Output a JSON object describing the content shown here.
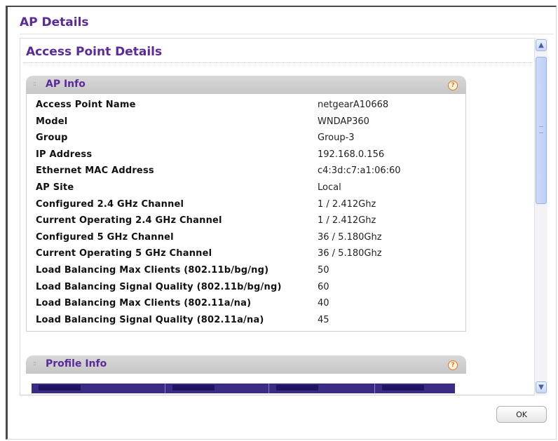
{
  "dialog": {
    "title": "AP Details",
    "ok_label": "OK"
  },
  "section": {
    "title": "Access Point Details"
  },
  "ap_info": {
    "title": "AP Info",
    "help": "?",
    "rows": [
      {
        "label": "Access Point Name",
        "value": "netgearA10668"
      },
      {
        "label": "Model",
        "value": "WNDAP360"
      },
      {
        "label": "Group",
        "value": "Group-3"
      },
      {
        "label": "IP Address",
        "value": "192.168.0.156"
      },
      {
        "label": "Ethernet MAC Address",
        "value": "c4:3d:c7:a1:06:60"
      },
      {
        "label": "AP Site",
        "value": "Local"
      },
      {
        "label": "Configured 2.4 GHz Channel",
        "value": "1 / 2.412Ghz"
      },
      {
        "label": "Current Operating 2.4 GHz Channel",
        "value": "1 / 2.412Ghz"
      },
      {
        "label": "Configured 5 GHz Channel",
        "value": "36 / 5.180Ghz"
      },
      {
        "label": "Current Operating 5 GHz Channel",
        "value": "36 / 5.180Ghz"
      },
      {
        "label": "Load Balancing Max Clients (802.11b/bg/ng)",
        "value": "50"
      },
      {
        "label": "Load Balancing Signal Quality (802.11b/bg/ng)",
        "value": "60"
      },
      {
        "label": "Load Balancing Max Clients (802.11a/na)",
        "value": "40"
      },
      {
        "label": "Load Balancing Signal Quality (802.11a/na)",
        "value": "45"
      }
    ]
  },
  "profile_info": {
    "title": "Profile Info",
    "help": "?"
  },
  "icons": {
    "help": "help-icon",
    "scroll_up": "chevron-up-icon",
    "scroll_down": "chevron-down-icon",
    "grip": "drag-handle-icon"
  },
  "colors": {
    "title": "#5a2a9a",
    "panel_header": "#d0d0d0",
    "table_header": "#3b2a86",
    "help_accent": "#e07a1a"
  }
}
